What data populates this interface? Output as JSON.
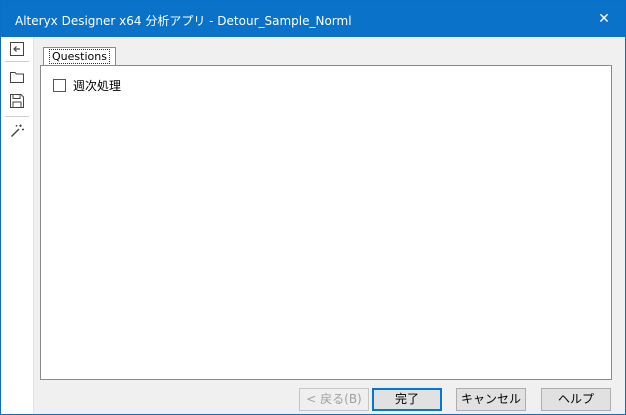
{
  "window": {
    "title": "Alteryx Designer x64 分析アプリ - Detour_Sample_Norml",
    "close_glyph": "✕"
  },
  "toolbar": {
    "items": [
      {
        "icon": "back-icon"
      },
      {
        "icon": "folder-open-icon"
      },
      {
        "icon": "save-icon"
      },
      {
        "icon": "magic-wand-icon"
      }
    ]
  },
  "tabs": [
    {
      "label": "Questions",
      "active": true
    }
  ],
  "questions": {
    "checkbox": {
      "label": "週次処理",
      "checked": false
    }
  },
  "footer": {
    "back_label": "< 戻る(B)",
    "finish_label": "完了",
    "cancel_label": "キャンセル",
    "help_label": "ヘルプ"
  },
  "colors": {
    "titlebar": "#0a72c8",
    "accent": "#0078d7"
  }
}
